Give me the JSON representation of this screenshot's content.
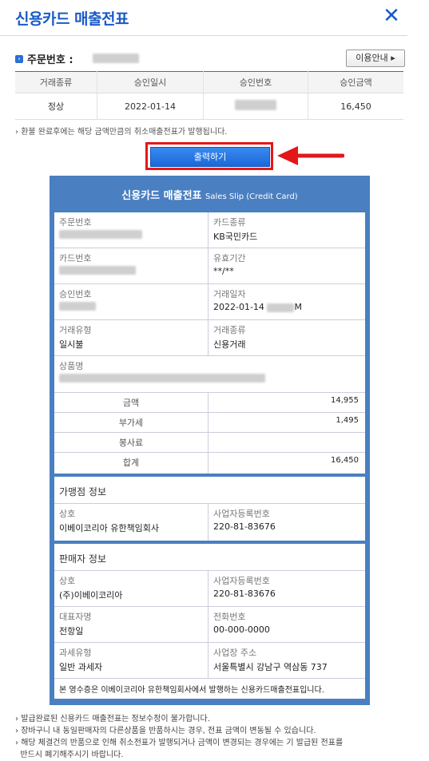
{
  "header": {
    "title": "신용카드 매출전표"
  },
  "order": {
    "label": "주문번호 :",
    "usage_button": "이용안내"
  },
  "summary_table": {
    "headers": [
      "거래종류",
      "승인일시",
      "승인번호",
      "승인금액"
    ],
    "row": {
      "type": "정상",
      "date": "2022-01-14",
      "amount": "16,450"
    }
  },
  "note_refund": "환불 완료후에는 해당 금액만큼의 취소매출전표가 발행됩니다.",
  "print_button": "출력하기",
  "slip": {
    "title": "신용카드 매출전표",
    "subtitle": "Sales Slip (Credit Card)",
    "order_no_label": "주문번호",
    "card_type_label": "카드종류",
    "card_type_value": "KB국민카드",
    "card_no_label": "카드번호",
    "expiry_label": "유효기간",
    "expiry_value": "**/**",
    "approval_no_label": "승인번호",
    "trade_date_label": "거래일자",
    "trade_date_value": "2022-01-14",
    "trade_date_suffix": "M",
    "trade_kind_label": "거래유형",
    "trade_kind_value": "일시불",
    "trade_type_label": "거래종류",
    "trade_type_value": "신용거래",
    "product_label": "상품명",
    "amounts": [
      {
        "label": "금액",
        "value": "14,955"
      },
      {
        "label": "부가세",
        "value": "1,495"
      },
      {
        "label": "봉사료",
        "value": ""
      },
      {
        "label": "합계",
        "value": "16,450"
      }
    ],
    "merchant_section": "가맹점 정보",
    "merchant_name_label": "상호",
    "merchant_name_value": "이베이코리아 유한책임회사",
    "merchant_bizno_label": "사업자등록번호",
    "merchant_bizno_value": "220-81-83676",
    "seller_section": "판매자 정보",
    "seller_name_label": "상호",
    "seller_name_value": "(주)이베이코리아",
    "seller_bizno_label": "사업자등록번호",
    "seller_bizno_value": "220-81-83676",
    "ceo_label": "대표자명",
    "ceo_value": "전항일",
    "phone_label": "전화번호",
    "phone_value": "00-000-0000",
    "tax_label": "과세유형",
    "tax_value": "일반 과세자",
    "address_label": "사업장 주소",
    "address_value": "서울특별시 강남구 역삼동 737",
    "footer": "본 영수증은 이베이코리아 유한책임회사에서 발행하는 신용카드매출전표입니다."
  },
  "bottom_notes": [
    "발급완료된 신용카드 매출전표는 정보수정이 불가합니다.",
    "장바구니 내 동일판매자의 다른상품을 반품하시는 경우, 전표 금액이 변동될 수 있습니다.",
    "해당 체결건의 반품으로 인해 취소전표가 발행되거나 금액이 변경되는 경우에는 기 발급된 전표를",
    "반드시 폐기해주시기 바랍니다."
  ],
  "colors": {
    "accent": "#1a5ac8",
    "slip_frame": "#4a7fc1",
    "highlight": "#e3171a"
  }
}
